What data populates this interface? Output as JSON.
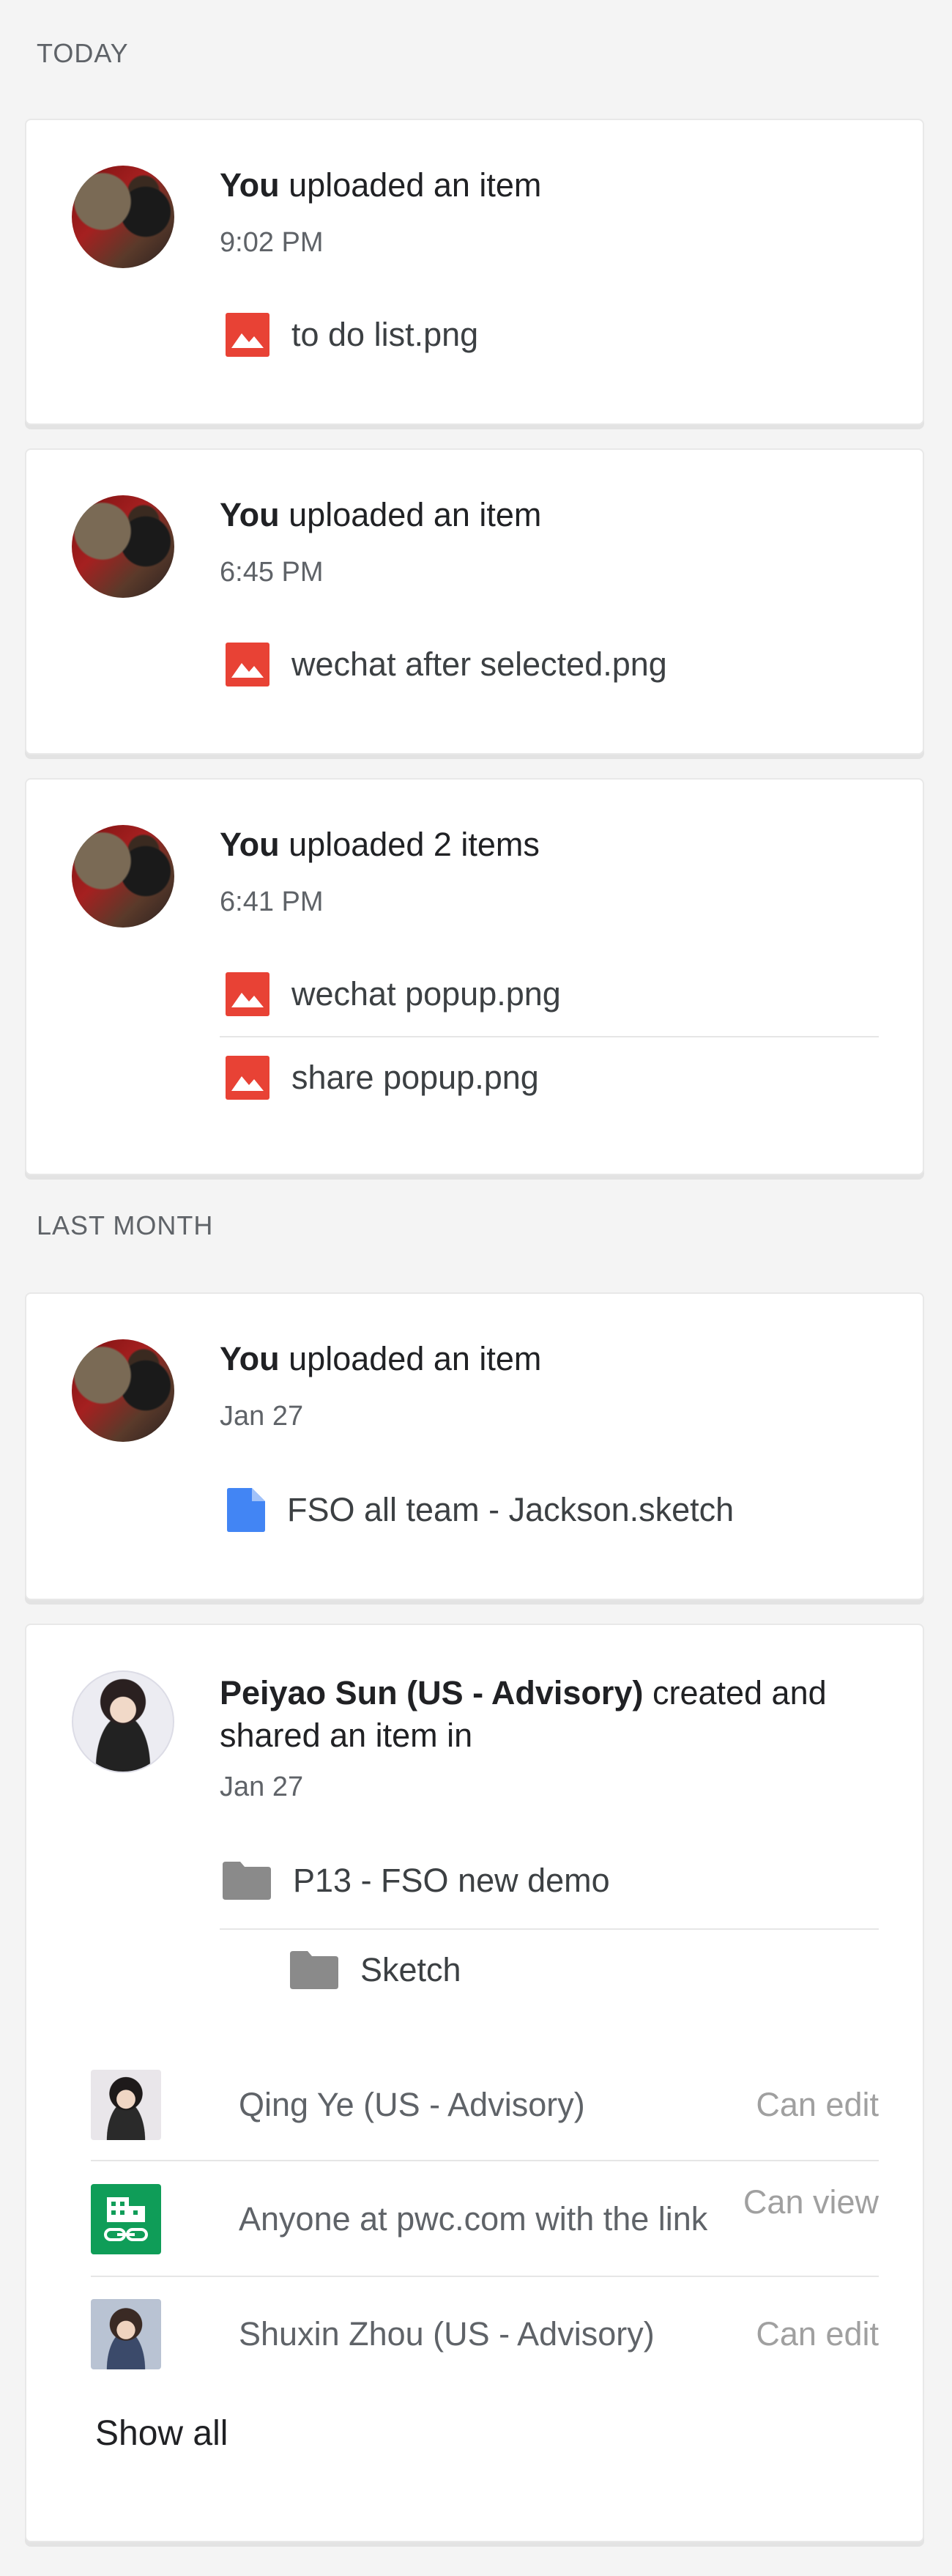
{
  "sections": {
    "today": "TODAY",
    "last_month": "LAST MONTH"
  },
  "activities": [
    {
      "actor": "You",
      "action": " uploaded an item",
      "time": "9:02 PM",
      "files": [
        {
          "name": "to do list.png",
          "icon": "image-icon"
        }
      ]
    },
    {
      "actor": "You",
      "action": " uploaded an item",
      "time": "6:45 PM",
      "files": [
        {
          "name": "wechat after selected.png",
          "icon": "image-icon"
        }
      ]
    },
    {
      "actor": "You",
      "action": " uploaded 2 items",
      "time": "6:41 PM",
      "files": [
        {
          "name": "wechat popup.png",
          "icon": "image-icon"
        },
        {
          "name": "share popup.png",
          "icon": "image-icon"
        }
      ]
    },
    {
      "actor": "You",
      "action": " uploaded an item",
      "time": "Jan 27",
      "files": [
        {
          "name": "FSO all team - Jackson.sketch",
          "icon": "document-icon"
        }
      ]
    },
    {
      "actor": "Peiyao Sun (US - Advisory)",
      "action": " created and shared an item in",
      "time": "Jan 27",
      "files": [
        {
          "name": "P13 - FSO new demo",
          "icon": "folder-icon"
        },
        {
          "name": "Sketch",
          "icon": "folder-icon"
        }
      ],
      "shared_with": [
        {
          "name": "Qing Ye (US - Advisory)",
          "permission": "Can edit"
        },
        {
          "name": "Anyone at pwc.com with the link",
          "permission": "Can view"
        },
        {
          "name": "Shuxin Zhou (US - Advisory)",
          "permission": "Can edit"
        }
      ],
      "show_all": "Show all"
    }
  ],
  "colors": {
    "image_icon": "#e84235",
    "doc_icon": "#4285f4",
    "folder_icon": "#8a8a8a",
    "domain_link_icon": "#0f9d58"
  }
}
